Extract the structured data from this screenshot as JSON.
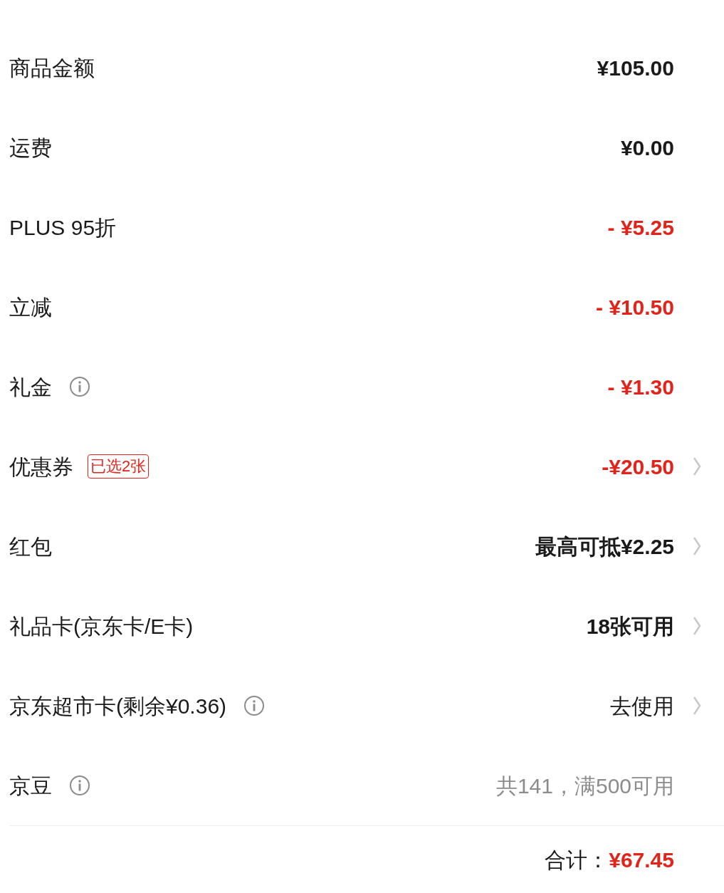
{
  "rows": [
    {
      "label": "商品金额",
      "info": false,
      "value": "¥105.00",
      "kind": "amount",
      "arrow": false
    },
    {
      "label": "运费",
      "info": false,
      "value": "¥0.00",
      "kind": "amount",
      "arrow": false
    },
    {
      "label": "PLUS 95折",
      "info": false,
      "value": "- ¥5.25",
      "kind": "discount",
      "arrow": false
    },
    {
      "label": "立减",
      "info": false,
      "value": "- ¥10.50",
      "kind": "discount",
      "arrow": false
    },
    {
      "label": "礼金",
      "info": true,
      "value": "- ¥1.30",
      "kind": "discount",
      "arrow": false
    },
    {
      "label": "优惠券",
      "info": false,
      "badge": "已选2张",
      "value": "-¥20.50",
      "kind": "discount",
      "arrow": true
    },
    {
      "label": "红包",
      "info": false,
      "value": "最高可抵¥2.25",
      "kind": "amount",
      "arrow": true
    },
    {
      "label": "礼品卡(京东卡/E卡)",
      "info": false,
      "value": "18张可用",
      "kind": "amount",
      "arrow": true
    },
    {
      "label": "京东超市卡(剩余¥0.36)",
      "info": true,
      "value": "去使用",
      "kind": "plain",
      "arrow": true
    },
    {
      "label": "京豆",
      "info": true,
      "value": "共141，满500可用",
      "kind": "muted",
      "arrow": false
    }
  ],
  "total": {
    "label": "合计：",
    "value": "¥67.45"
  }
}
